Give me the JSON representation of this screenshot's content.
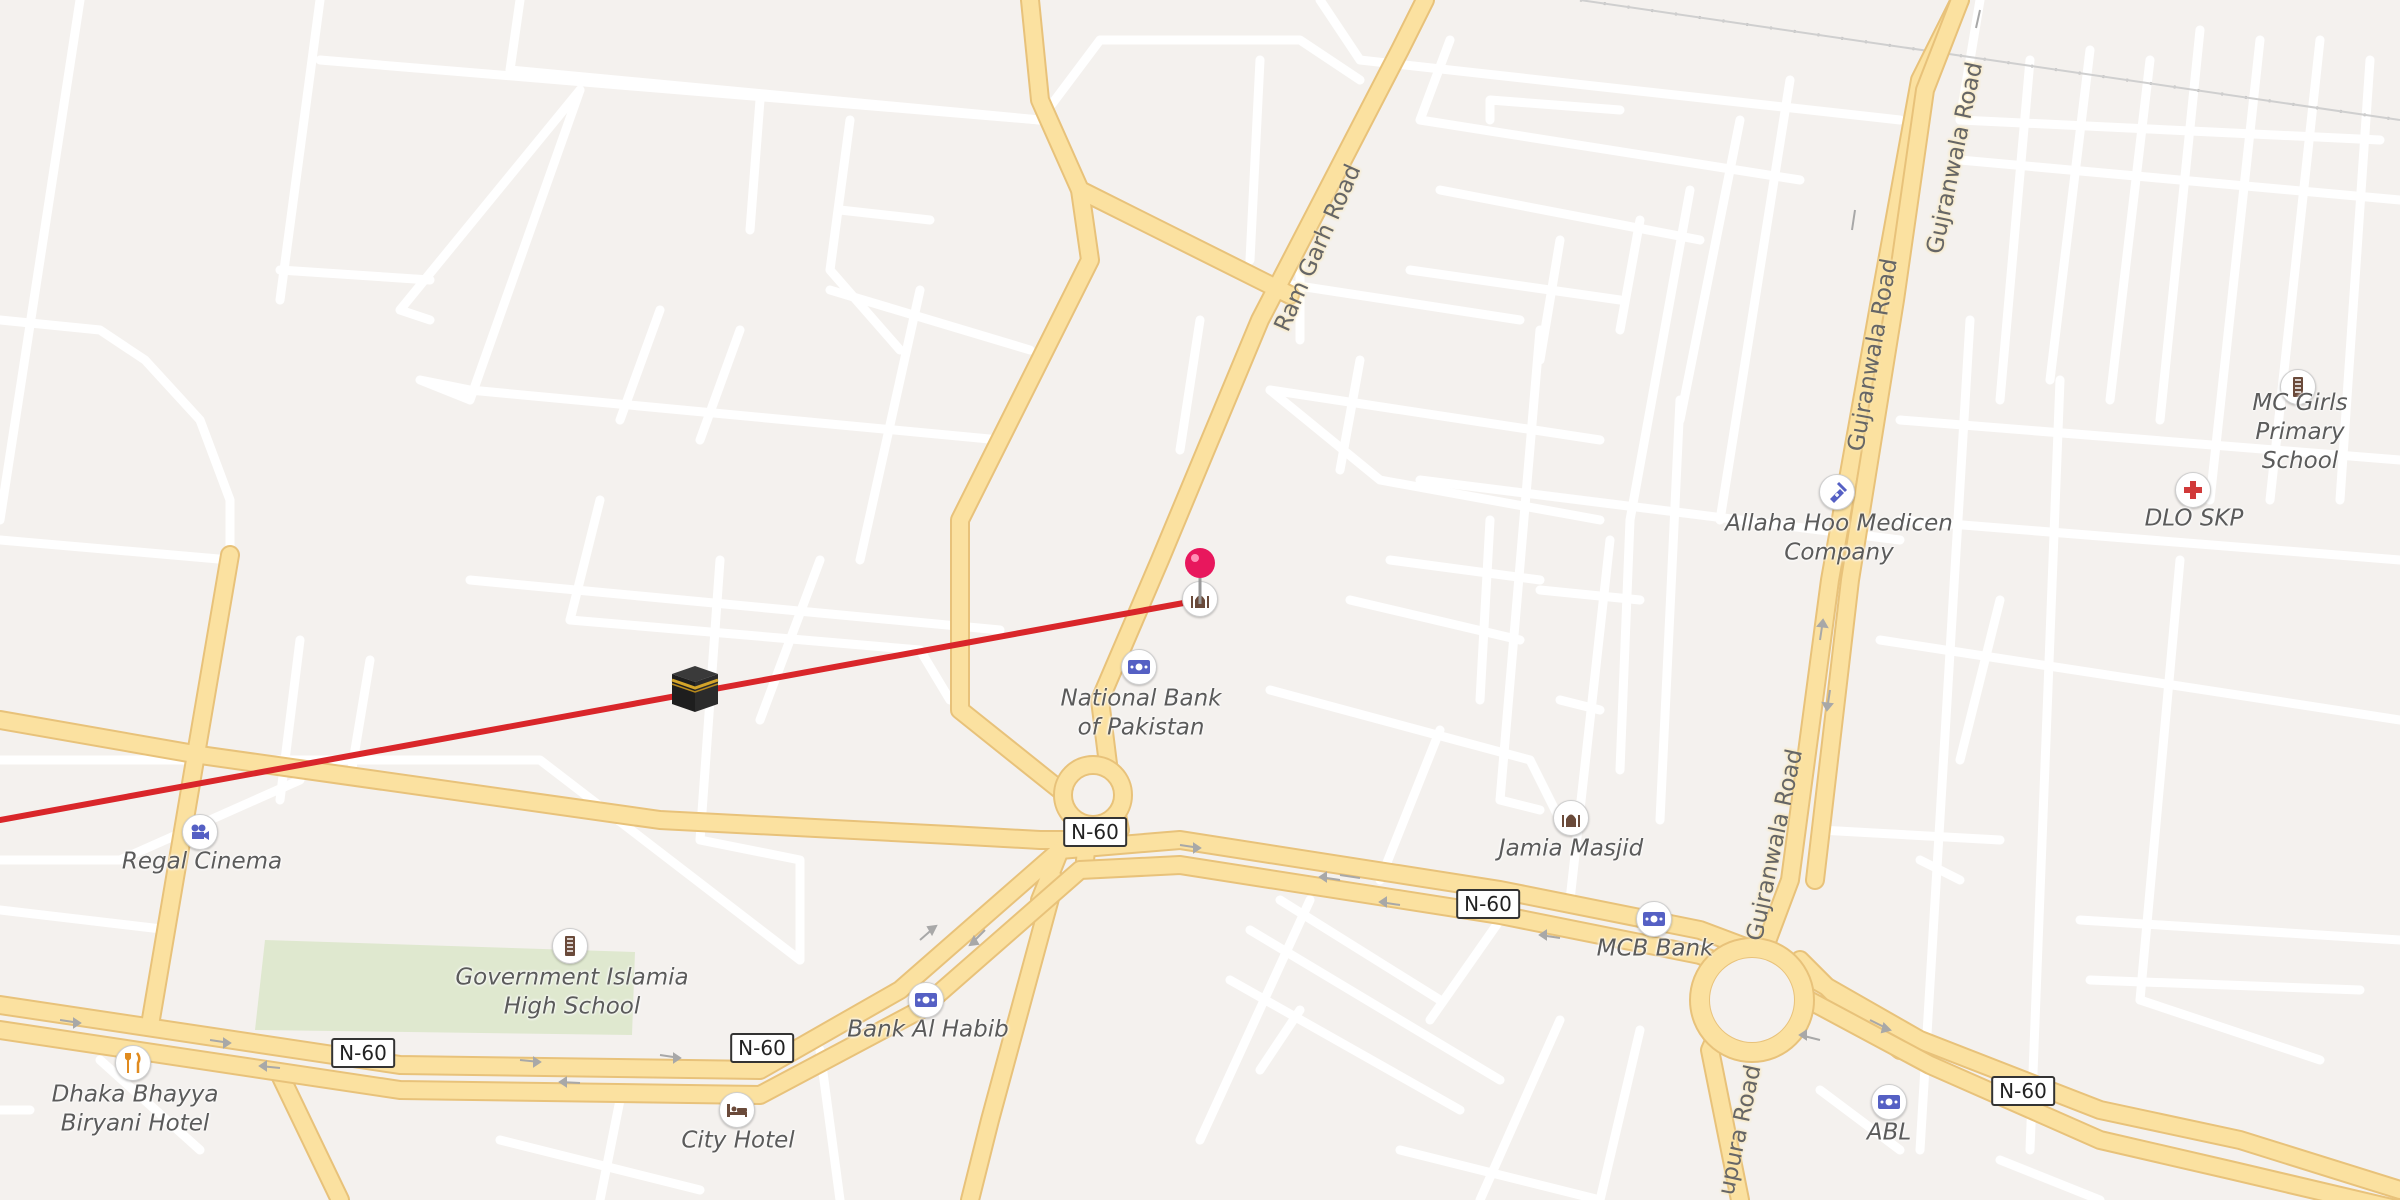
{
  "map": {
    "colors": {
      "background": "#f4f1ee",
      "minor_road": "#ffffff",
      "major_road": "#fbe1a0",
      "major_road_casing": "#e8c27a",
      "park": "#dfe8cf",
      "route_line": "#d9262a",
      "pin": "#e8175d"
    },
    "road_names": {
      "ram_garh": "Ram Garh Road",
      "gujranwala_1": "Gujranwala Road",
      "gujranwala_2": "Gujranwala Road",
      "gujranwala_3": "Gujranwala Road",
      "partial_road": "upura Road"
    },
    "shields": {
      "n60_a": "N-60",
      "n60_b": "N-60",
      "n60_c": "N-60",
      "n60_d": "N-60",
      "n60_e": "N-60"
    },
    "places": {
      "national_bank": "National Bank\nof Pakistan",
      "regal_cinema": "Regal Cinema",
      "govt_school": "Government Islamia\nHigh School",
      "bank_al_habib": "Bank Al Habib",
      "dhaka_biryani": "Dhaka Bhayya\nBiryani Hotel",
      "city_hotel": "City Hotel",
      "jamia_masjid": "Jamia Masjid",
      "mcb_bank": "MCB Bank",
      "abl": "ABL",
      "allaha_hoo": "Allaha Hoo Medicen\nCompany",
      "dlo_skp": "DLO SKP",
      "mc_girls": "MC Girls\nPrimary School"
    },
    "icons": {
      "bank": "banknote-icon",
      "cinema": "camera-icon",
      "school": "school-icon",
      "restaurant": "fork-knife-icon",
      "hotel": "bed-icon",
      "mosque": "mosque-icon",
      "pharmacy": "pharmacy-icon",
      "hospital": "red-cross-icon",
      "destination": "pin-icon",
      "qibla": "kaaba-icon"
    }
  }
}
